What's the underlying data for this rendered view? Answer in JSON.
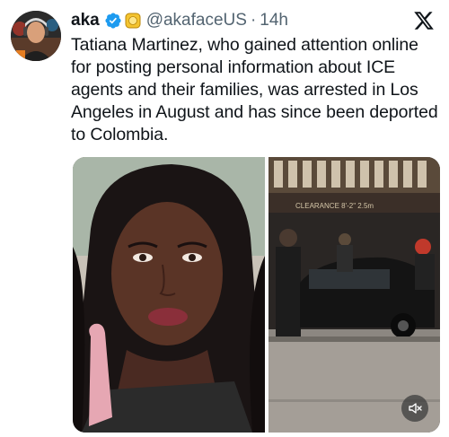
{
  "tweet": {
    "display_name": "aka",
    "handle": "@akafaceUS",
    "separator": "·",
    "time": "14h",
    "text": "Tatiana Martinez, who gained attention online for posting personal information about ICE agents and their families, was arrested in Los Angeles in August and has since been deported to Colombia."
  },
  "media": {
    "sign_text": "CLEARANCE  8'-2\" 2.5m"
  },
  "icons": {
    "verified": "verified-badge-icon",
    "affiliate": "gold-affiliate-badge-icon",
    "platform": "x-logo-icon",
    "mute": "speaker-muted-icon"
  },
  "colors": {
    "verified_blue": "#1d9bf0",
    "secondary_text": "#536471",
    "primary_text": "#0f1419"
  }
}
